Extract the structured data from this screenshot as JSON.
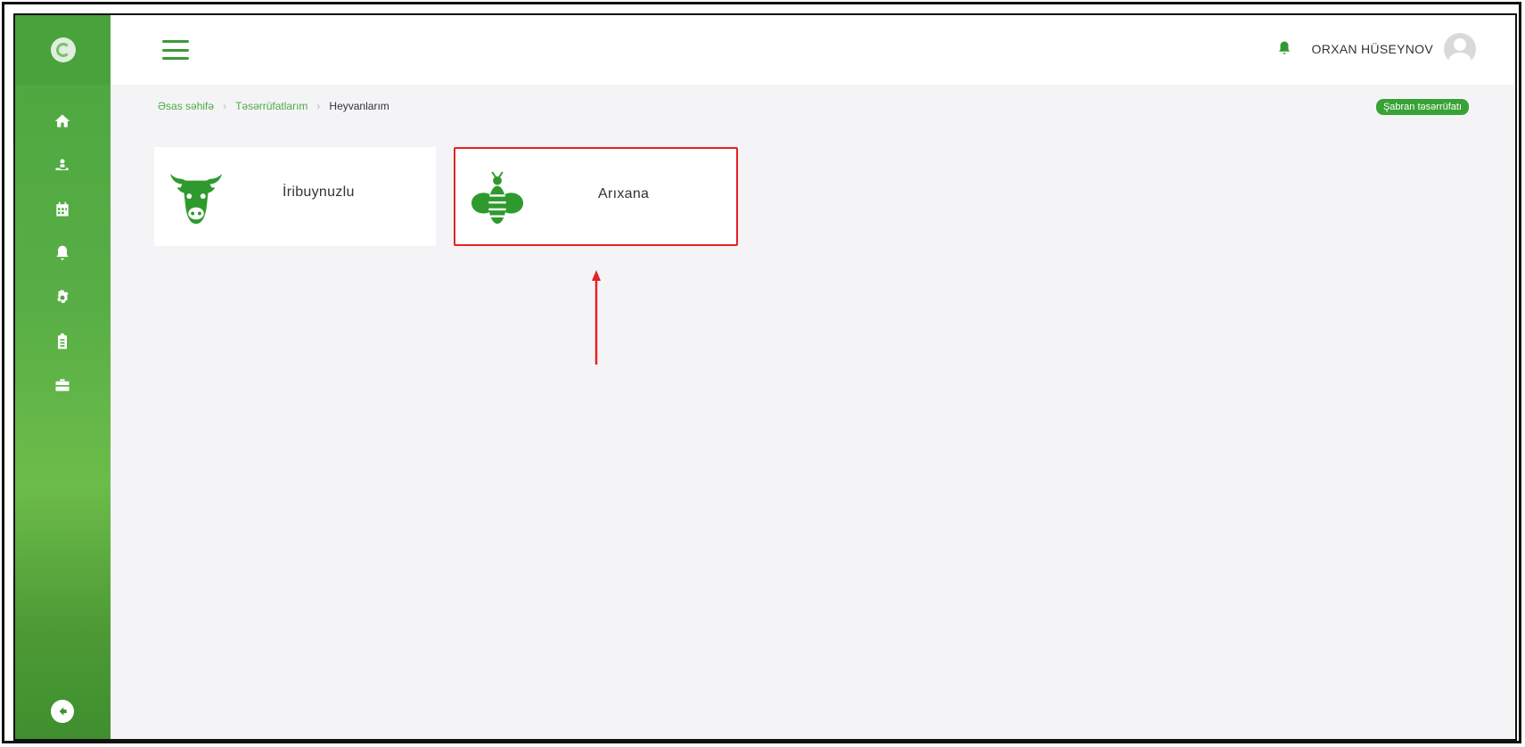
{
  "header": {
    "user_name": "ORXAN HÜSEYNOV"
  },
  "sidebar": {
    "icons": [
      "home-icon",
      "hand-holding-icon",
      "calendar-icon",
      "bell-icon",
      "gear-icon",
      "clipboard-icon",
      "briefcase-icon"
    ],
    "back_icon": "arrow-left-icon"
  },
  "breadcrumb": {
    "items": [
      "Əsas səhifə",
      "Təsərrüfatlarım"
    ],
    "current": "Heyvanlarım"
  },
  "farm_badge": "Şabran təsərrüfatı",
  "cards": [
    {
      "label": "İribuynuzlu",
      "icon": "cow-icon"
    },
    {
      "label": "Arıxana",
      "icon": "bee-icon"
    }
  ],
  "colors": {
    "brand_green": "#38a235",
    "highlight_red": "#e52222"
  }
}
